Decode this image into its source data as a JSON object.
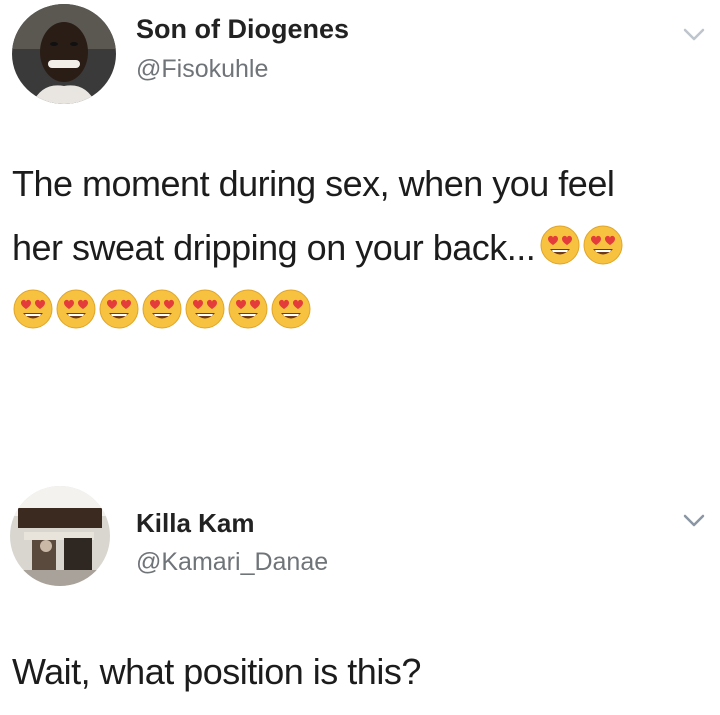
{
  "tweets": [
    {
      "display_name": "Son of Diogenes",
      "handle": "@Fisokuhle",
      "text_line1": "The moment during sex, when you feel",
      "text_line2": "her sweat dripping on your back...",
      "inline_emoji_count": 2,
      "trailing_emoji_count": 7,
      "emoji": "smiling-face-with-heart-eyes",
      "menu_icon": "chevron-down-icon"
    },
    {
      "display_name": "Killa Kam",
      "handle": "@Kamari_Danae",
      "text": "Wait, what position is this?",
      "menu_icon": "chevron-down-icon"
    }
  ],
  "colors": {
    "text": "#1c1c1c",
    "handle": "#6f7479",
    "chevron": "#8a96a3",
    "emoji_face": "#f7c23f"
  }
}
